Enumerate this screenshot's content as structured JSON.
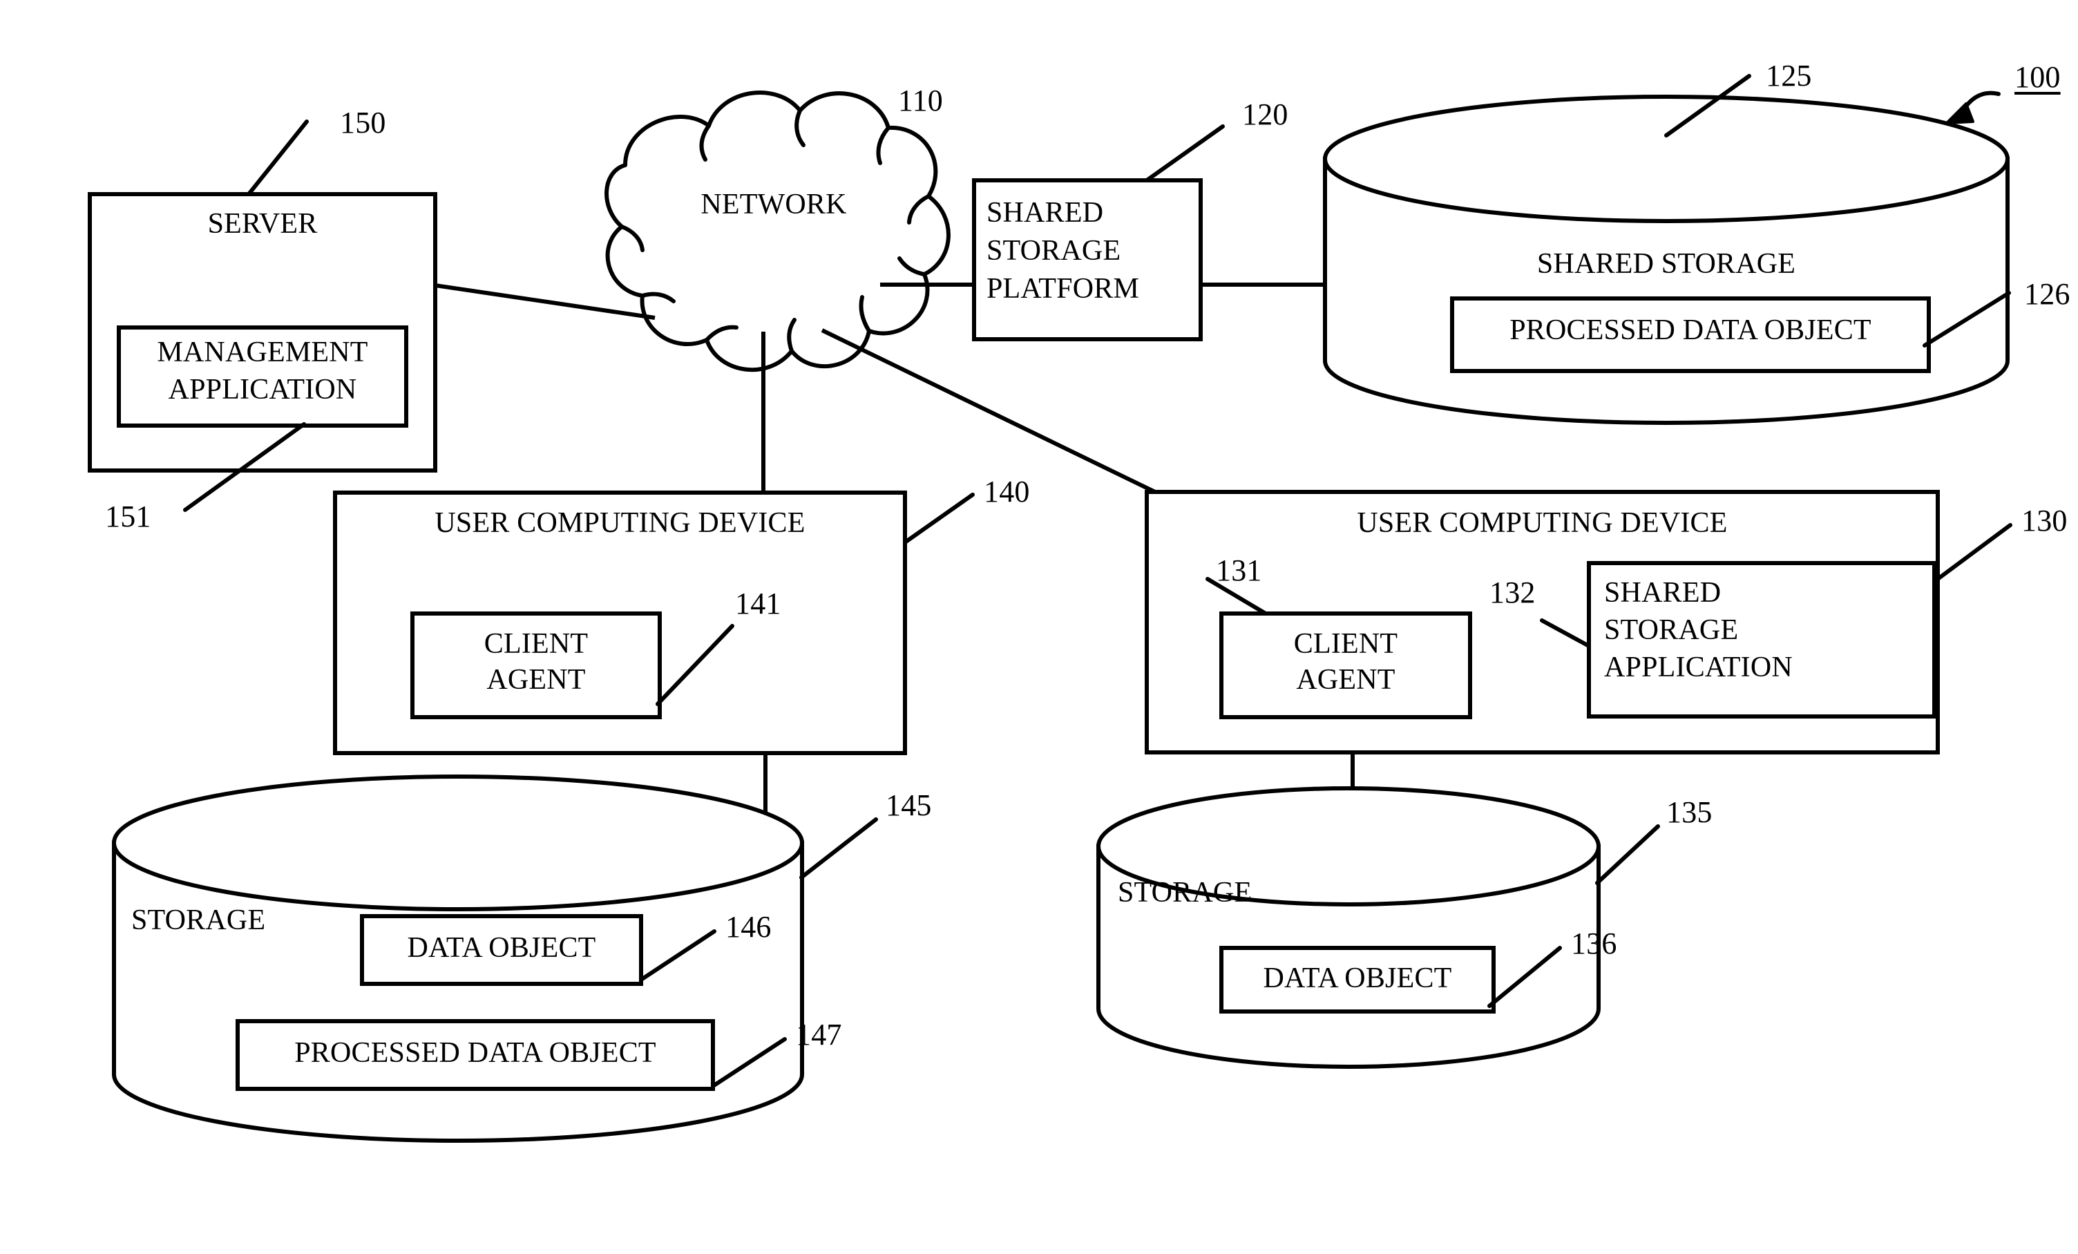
{
  "figure": {
    "reference_numeral": "100",
    "nodes": {
      "server": {
        "label": "SERVER",
        "ref": "150",
        "inner": {
          "label_line1": "MANAGEMENT",
          "label_line2": "APPLICATION",
          "label_full": "MANAGEMENT APPLICATION",
          "ref": "151"
        }
      },
      "network": {
        "label": "NETWORK",
        "ref": "110"
      },
      "shared_storage_platform": {
        "label_line1": "SHARED",
        "label_line2": "STORAGE",
        "label_line3": "PLATFORM",
        "label_full": "SHARED STORAGE PLATFORM",
        "ref": "120"
      },
      "shared_storage": {
        "label": "SHARED STORAGE",
        "ref": "125",
        "inner": {
          "label": "PROCESSED DATA OBJECT",
          "ref": "126"
        }
      },
      "user_computing_device_left": {
        "label": "USER COMPUTING DEVICE",
        "ref": "140",
        "client_agent": {
          "label_line1": "CLIENT",
          "label_line2": "AGENT",
          "label_full": "CLIENT AGENT",
          "ref": "141"
        }
      },
      "user_computing_device_right": {
        "label": "USER COMPUTING DEVICE",
        "ref": "130",
        "client_agent": {
          "label_line1": "CLIENT",
          "label_line2": "AGENT",
          "label_full": "CLIENT AGENT",
          "ref": "131"
        },
        "shared_storage_application": {
          "label_line1": "SHARED",
          "label_line2": "STORAGE",
          "label_line3": "APPLICATION",
          "label_full": "SHARED STORAGE APPLICATION",
          "ref": "132"
        }
      },
      "storage_left": {
        "label": "STORAGE",
        "ref": "145",
        "data_object": {
          "label": "DATA OBJECT",
          "ref": "146"
        },
        "processed_data_object": {
          "label": "PROCESSED DATA OBJECT",
          "ref": "147"
        }
      },
      "storage_right": {
        "label": "STORAGE",
        "ref": "135",
        "data_object": {
          "label": "DATA OBJECT",
          "ref": "136"
        }
      }
    },
    "colors": {
      "ink": "#000000",
      "paper": "#ffffff"
    }
  }
}
